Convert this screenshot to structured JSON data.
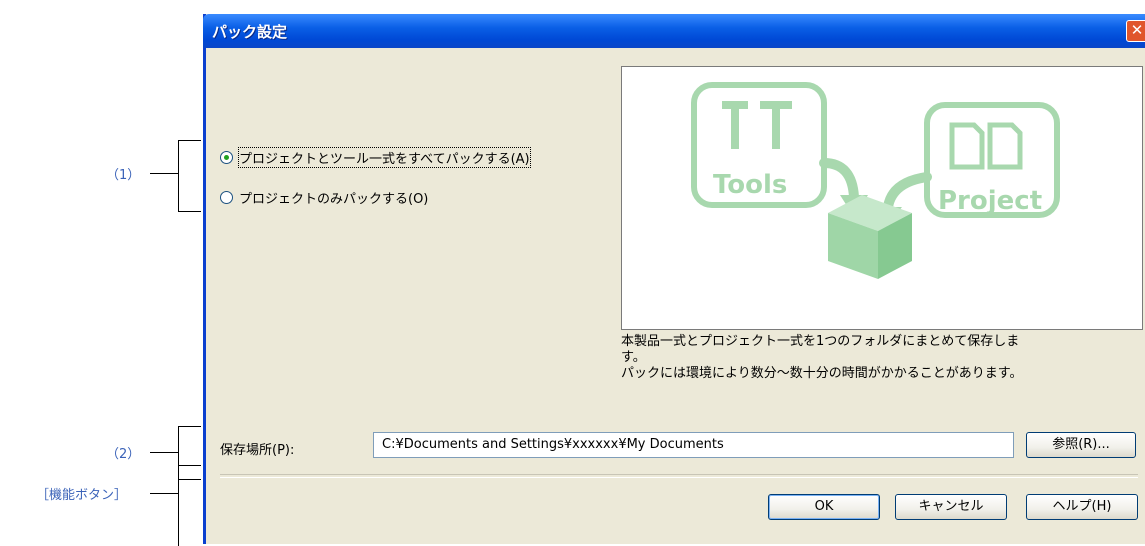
{
  "annotations": {
    "item1": "（1）",
    "item2": "（2）",
    "function_buttons": "［機能ボタン］"
  },
  "dialog": {
    "title": "パック設定",
    "close_glyph": "✕",
    "radio_options": [
      {
        "label": "プロジェクトとツール一式をすべてパックする(A)",
        "checked": true
      },
      {
        "label": "プロジェクトのみパックする(O)",
        "checked": false
      }
    ],
    "illustration": {
      "tools_label": "Tools",
      "project_label": "Project",
      "accent_color": "#a8d8ae"
    },
    "description_lines": [
      "本製品一式とプロジェクト一式を1つのフォルダにまとめて保存しま",
      "す。",
      "パックには環境により数分～数十分の時間がかかることがあります。"
    ],
    "path_label": "保存場所(P):",
    "path_value": "C:¥Documents and Settings¥xxxxxx¥My Documents",
    "browse_label": "参照(R)...",
    "ok_label": "OK",
    "cancel_label": "キャンセル",
    "help_label": "ヘルプ(H)"
  }
}
